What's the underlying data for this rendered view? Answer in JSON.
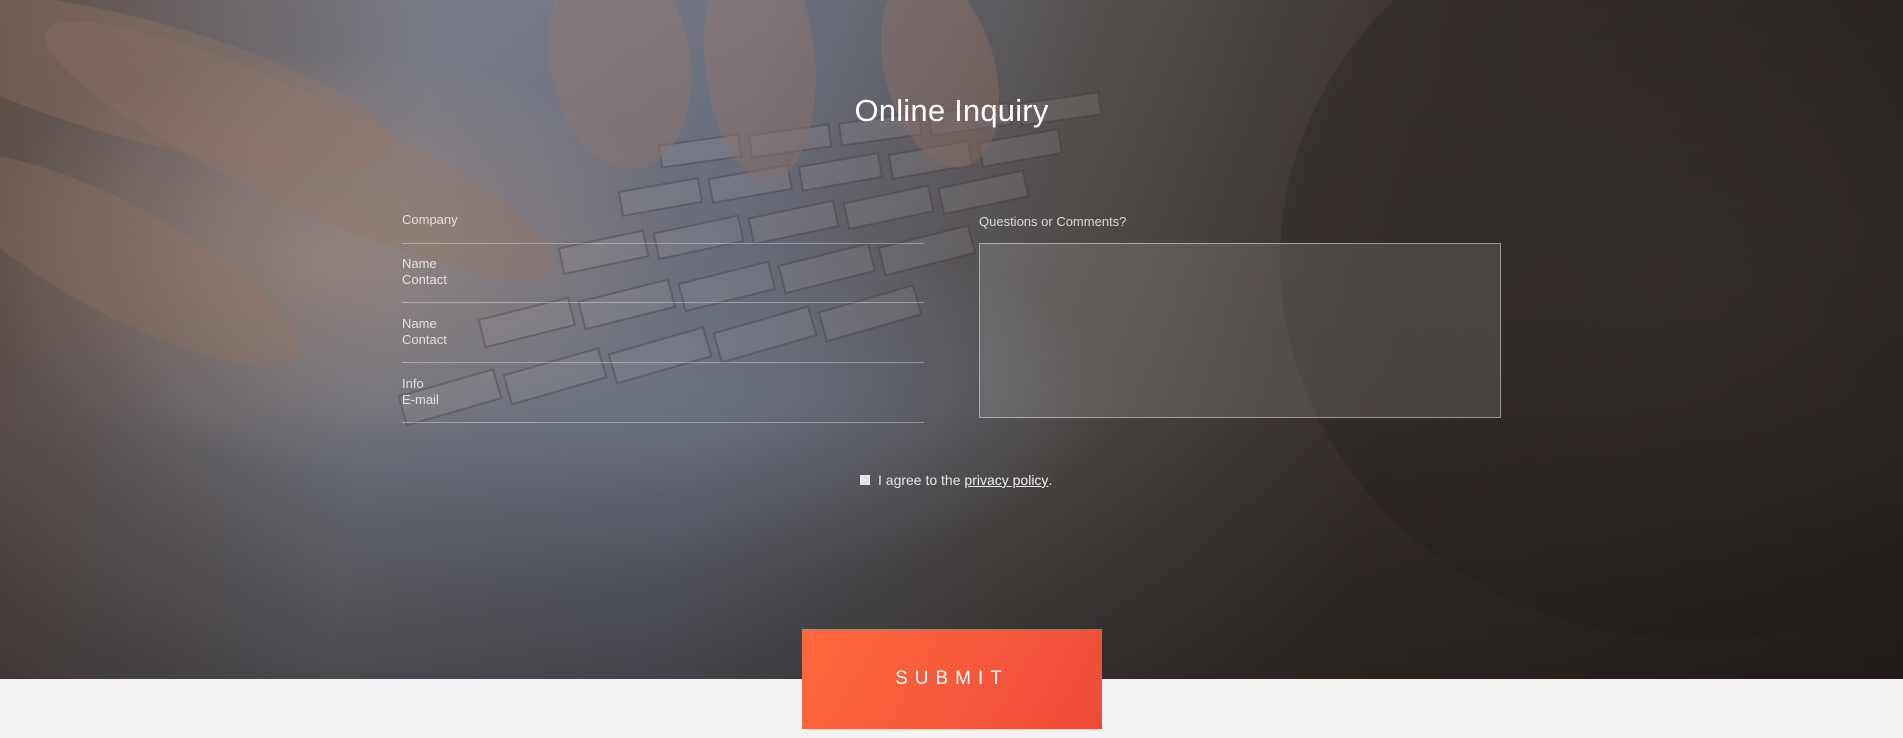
{
  "form": {
    "title": "Online Inquiry",
    "fields": [
      {
        "placeholder_line1": "Company",
        "placeholder_line2": ""
      },
      {
        "placeholder_line1": "Name",
        "placeholder_line2": "Contact"
      },
      {
        "placeholder_line1": "Name",
        "placeholder_line2": "Contact"
      },
      {
        "placeholder_line1": "Info",
        "placeholder_line2": "E-mail"
      }
    ],
    "comments_label": "Questions or Comments?",
    "comments_value": "",
    "agree_prefix": "I agree to the",
    "agree_link": "privacy policy",
    "agree_suffix": ".",
    "agree_checked": false,
    "submit_label": "SUBMIT"
  },
  "colors": {
    "submit_start": "#ff6a3c",
    "submit_end": "#ee4a3a",
    "footer_bg": "#f3f3f3"
  },
  "background": {
    "image_subject": "hands typing on laptop keyboard"
  }
}
